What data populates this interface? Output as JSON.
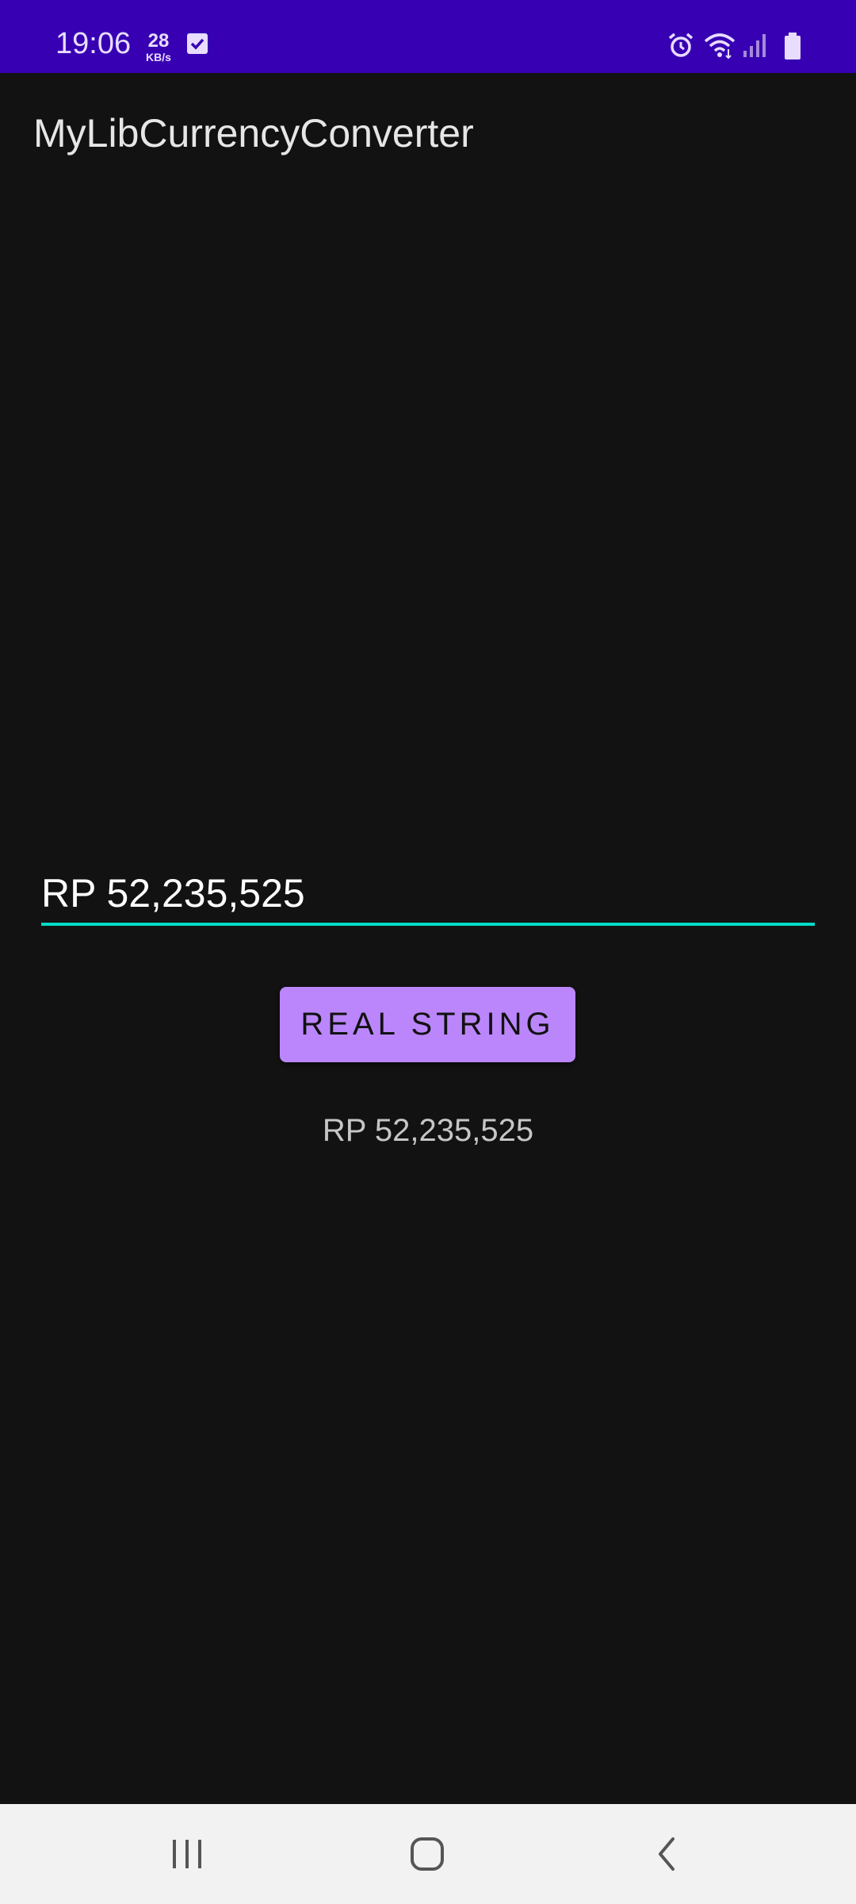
{
  "status_bar": {
    "time": "19:06",
    "speed_value": "28",
    "speed_unit": "KB/s",
    "icons": [
      "checkbox-notification-icon",
      "alarm-icon",
      "wifi-icon",
      "signal-icon",
      "battery-icon"
    ],
    "background_color": "#3700b3"
  },
  "app_bar": {
    "title": "MyLibCurrencyConverter"
  },
  "form": {
    "input_value": "RP 52,235,525",
    "underline_color": "#03dac5",
    "button_label": "REAL STRING",
    "button_color": "#bb86fc",
    "result_text": "RP 52,235,525"
  },
  "nav_bar": {
    "icons": [
      "recents-icon",
      "home-icon",
      "back-icon"
    ]
  }
}
